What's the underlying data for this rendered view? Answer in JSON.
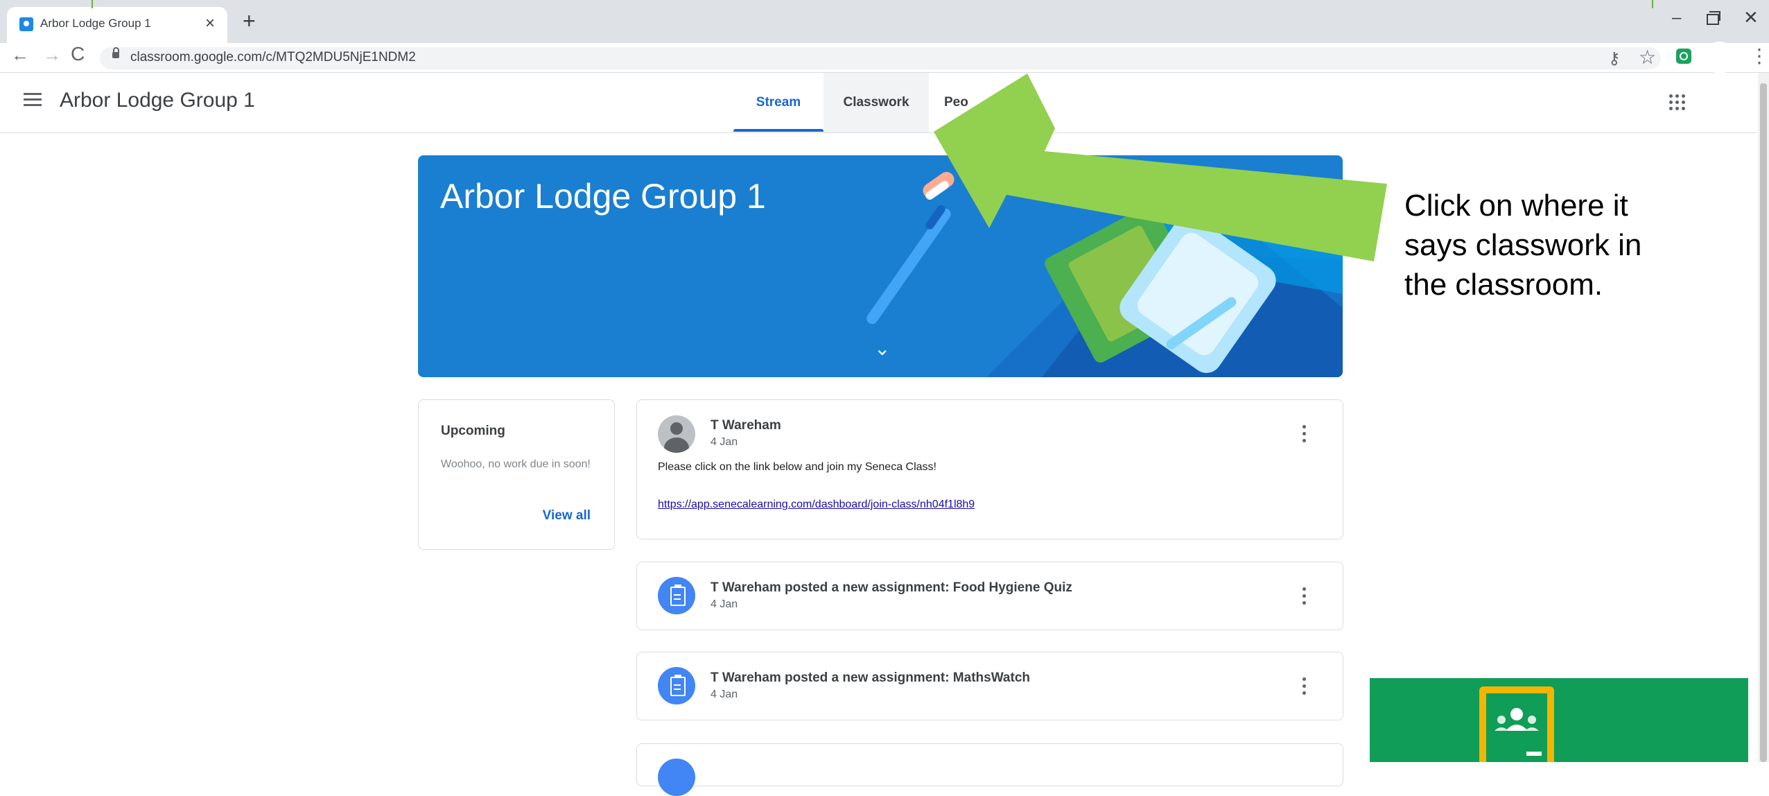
{
  "browser": {
    "tab_title": "Arbor Lodge Group 1",
    "tab_close": "×",
    "new_tab": "+",
    "url": "classroom.google.com/c/MTQ2MDU5NjE1NDM2",
    "window_controls": {
      "minimize": "–",
      "close": "✕"
    },
    "nav": {
      "back": "←",
      "forward": "→",
      "reload": "C"
    },
    "icons": {
      "key": "key-icon",
      "star": "star-icon",
      "menu": "⋮"
    }
  },
  "header": {
    "class_title": "Arbor Lodge Group 1",
    "tabs": [
      {
        "label": "Stream",
        "active": true
      },
      {
        "label": "Classwork",
        "active": false
      },
      {
        "label": "Peo",
        "active": false
      }
    ]
  },
  "banner": {
    "title": "Arbor Lodge Group 1",
    "chevron": "⌄",
    "color": "#1a7fd0"
  },
  "upcoming": {
    "title": "Upcoming",
    "empty_text": "Woohoo, no work due in soon!",
    "view_all": "View all"
  },
  "posts": [
    {
      "author": "T Wareham",
      "date": "4 Jan",
      "text": "Please click on the link below and join my Seneca Class!",
      "link": "https://app.senecalearning.com/dashboard/join-class/nh04f1l8h9"
    },
    {
      "title": "T Wareham posted a new assignment: Food Hygiene Quiz",
      "date": "4 Jan"
    },
    {
      "title": "T Wareham posted a new assignment: MathsWatch",
      "date": "4 Jan"
    }
  ],
  "annotation": {
    "caption": "Click on where it says classwork in the classroom.",
    "arrow_color": "#92d050"
  },
  "colors": {
    "accent": "#1967d2",
    "assignment_icon": "#4285f4",
    "logo_green": "#0f9d58",
    "logo_yellow": "#f4b400"
  }
}
